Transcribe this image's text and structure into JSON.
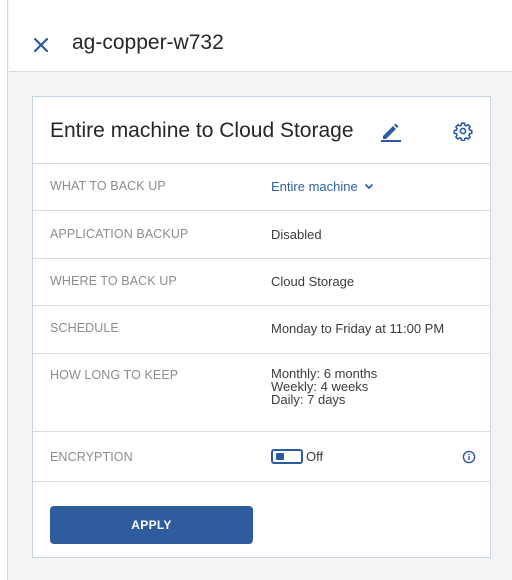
{
  "header": {
    "title": "ag-copper-w732"
  },
  "plan": {
    "title": "Entire machine to Cloud Storage",
    "rows": [
      {
        "label": "WHAT TO BACK UP",
        "value": "Entire machine"
      },
      {
        "label": "APPLICATION BACKUP",
        "value": "Disabled"
      },
      {
        "label": "WHERE TO BACK UP",
        "value": "Cloud Storage"
      },
      {
        "label": "SCHEDULE",
        "value": "Monday to Friday at 11:00 PM"
      },
      {
        "label": "HOW LONG TO KEEP",
        "values": [
          "Monthly: 6 months",
          "Weekly: 4 weeks",
          "Daily: 7 days"
        ]
      },
      {
        "label": "ENCRYPTION",
        "toggle_state": "Off"
      }
    ],
    "apply_label": "APPLY"
  },
  "colors": {
    "accent": "#2e5c9c",
    "link": "#2e63a6",
    "card_border": "#c5d3e3",
    "background": "#f4f4f4"
  },
  "icons": [
    "close-icon",
    "pencil-icon",
    "gear-icon",
    "chevron-down-icon",
    "info-icon"
  ]
}
